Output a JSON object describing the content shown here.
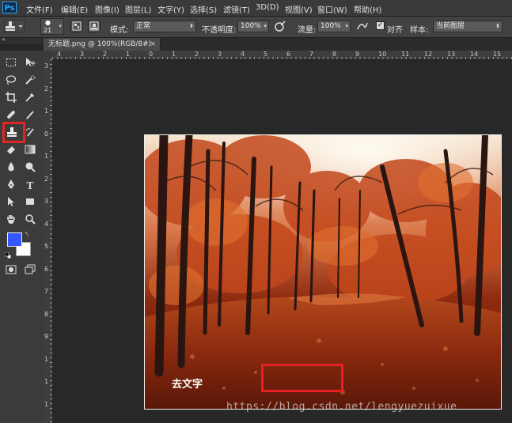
{
  "app": {
    "logo": "Ps"
  },
  "menu": [
    "文件(F)",
    "编辑(E)",
    "图像(I)",
    "图层(L)",
    "文字(Y)",
    "选择(S)",
    "滤镜(T)",
    "3D(D)",
    "视图(V)",
    "窗口(W)",
    "帮助(H)"
  ],
  "options": {
    "brush_size": "21",
    "mode_label": "模式:",
    "mode_value": "正常",
    "opacity_label": "不透明度:",
    "opacity_value": "100%",
    "flow_label": "流量:",
    "flow_value": "100%",
    "align_label": "对齐",
    "align_checked": true,
    "sample_label": "样本:",
    "sample_value": "当前图层"
  },
  "document": {
    "tab_title": "无标题.png @ 100%(RGB/8#)",
    "close": "×"
  },
  "ruler_top": [
    "4",
    "3",
    "2",
    "1",
    "0",
    "1",
    "2",
    "3",
    "4",
    "5",
    "6",
    "7",
    "8",
    "9",
    "10",
    "11",
    "12",
    "13",
    "14",
    "15"
  ],
  "ruler_left": [
    "3",
    "2",
    "1",
    "0",
    "1",
    "2",
    "3",
    "4",
    "5",
    "6",
    "7",
    "8",
    "9",
    "1",
    "1",
    "1"
  ],
  "tools": {
    "active": "clone-stamp",
    "foreground_color": "#3356ff",
    "background_color": "#ffffff"
  },
  "annotation": {
    "caption": "去文字",
    "highlight_color": "#e52020"
  },
  "watermark": "https://blog.csdn.net/lengyuezuixue"
}
